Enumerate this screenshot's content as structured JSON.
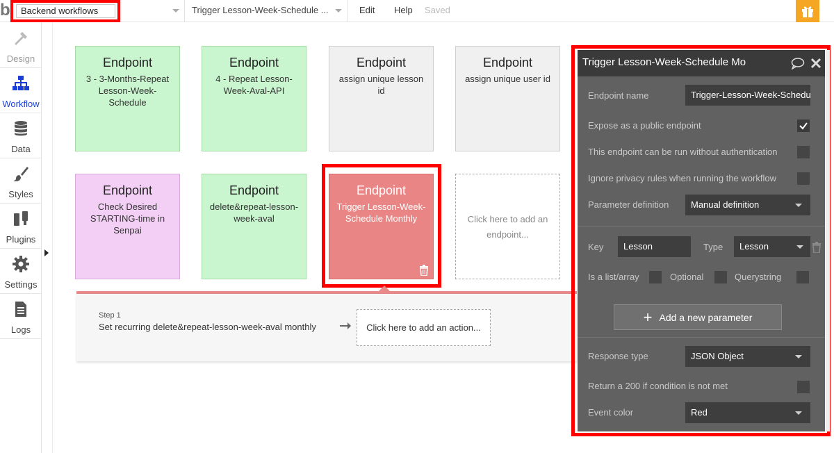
{
  "topbar": {
    "logo": "b",
    "page_select": "Backend workflows",
    "workflow_select": "Trigger Lesson-Week-Schedule ...",
    "menu_edit": "Edit",
    "menu_help": "Help",
    "status": "Saved"
  },
  "sidebar": {
    "items": [
      {
        "label": "Design",
        "icon": "design-icon"
      },
      {
        "label": "Workflow",
        "icon": "workflow-icon"
      },
      {
        "label": "Data",
        "icon": "database-icon"
      },
      {
        "label": "Styles",
        "icon": "brush-icon"
      },
      {
        "label": "Plugins",
        "icon": "plug-icon"
      },
      {
        "label": "Settings",
        "icon": "gear-icon"
      },
      {
        "label": "Logs",
        "icon": "document-icon"
      }
    ]
  },
  "endpoints": {
    "title": "Endpoint",
    "cards": [
      {
        "name": "3 - 3-Months-Repeat Lesson-Week-Schedule",
        "color": "#c9f5cf"
      },
      {
        "name": "4 - Repeat Lesson-Week-Aval-API",
        "color": "#c9f5cf"
      },
      {
        "name": "assign unique lesson id",
        "color": "#f0f0f0"
      },
      {
        "name": "assign unique user id",
        "color": "#f0f0f0"
      },
      {
        "name": "Check Desired STARTING-time in Senpai",
        "color": "#f3cff5"
      },
      {
        "name": "delete&repeat-lesson-week-aval",
        "color": "#c9f5cf"
      },
      {
        "name": "Trigger Lesson-Week-Schedule Monthly",
        "color": "#e98585"
      }
    ],
    "add_placeholder": "Click here to add an endpoint..."
  },
  "step": {
    "label": "Step 1",
    "name": "Set recurring delete&repeat-lesson-week-aval monthly",
    "add_action": "Click here to add an action..."
  },
  "editor": {
    "title": "Trigger Lesson-Week-Schedule Mo",
    "endpoint_name_label": "Endpoint name",
    "endpoint_name_value": "Trigger-Lesson-Week-Schedule-M",
    "expose_public_label": "Expose as a public endpoint",
    "expose_public_checked": true,
    "no_auth_label": "This endpoint can be run without authentication",
    "ignore_privacy_label": "Ignore privacy rules when running the workflow",
    "param_def_label": "Parameter definition",
    "param_def_value": "Manual definition",
    "key_label": "Key",
    "key_value": "Lesson",
    "type_label": "Type",
    "type_value": "Lesson",
    "is_list_label": "Is a list/array",
    "optional_label": "Optional",
    "querystring_label": "Querystring",
    "add_param_label": "Add a new parameter",
    "response_type_label": "Response type",
    "response_type_value": "JSON Object",
    "return_200_label": "Return a 200 if condition is not met",
    "event_color_label": "Event color",
    "event_color_value": "Red"
  },
  "colors": {
    "highlight": "#ff0000",
    "selected_card": "#e98585",
    "accent_blue": "#1a3fd6",
    "gift": "#f5a623"
  }
}
